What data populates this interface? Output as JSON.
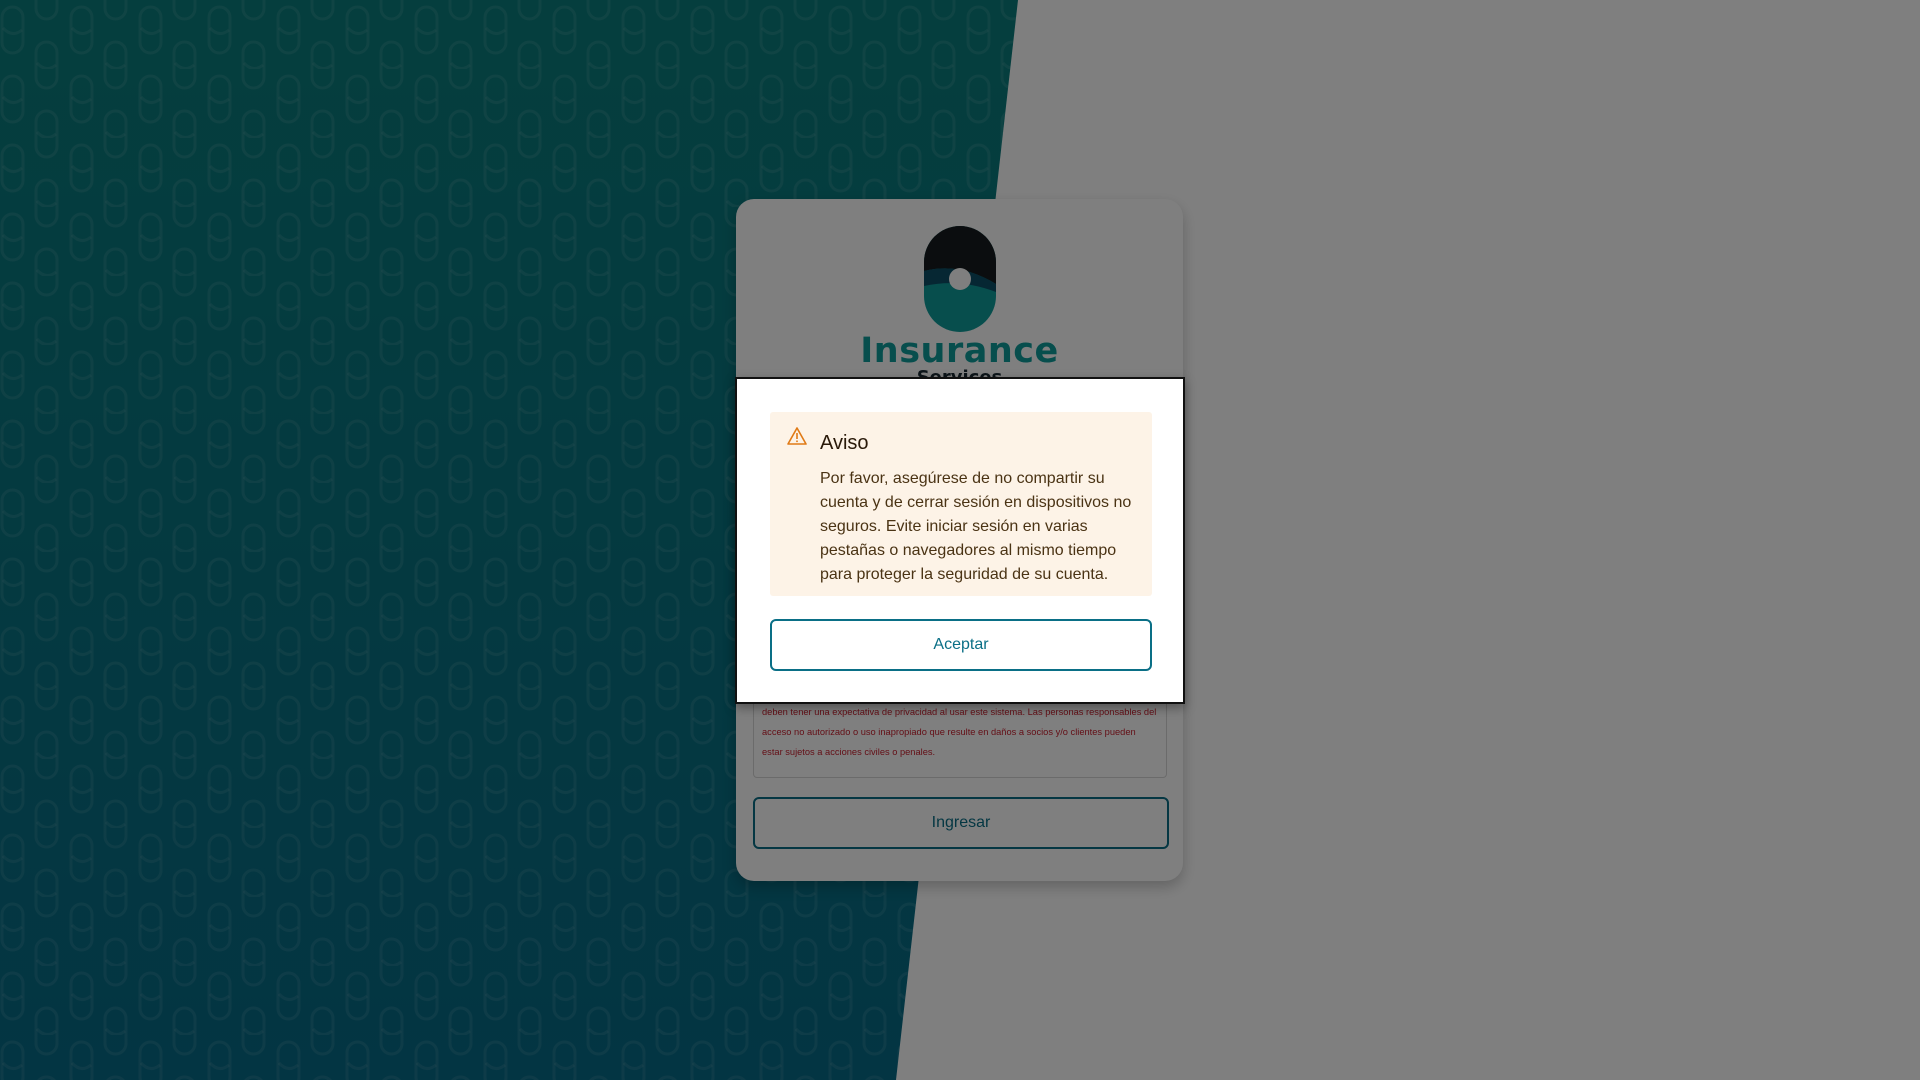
{
  "colors": {
    "teal_top": "#0a7d7c",
    "teal_bottom": "#076a86",
    "brand_teal": "#0f9c9a",
    "button_accent": "#0a6f86",
    "legal_red": "#c8202f",
    "alert_bg": "#fdf3e7",
    "warning_orange": "#e07a16"
  },
  "login": {
    "brand_name": "Insurance",
    "brand_subtitle": "Services",
    "legal_notice": "Este sistema está restringido a personal autorizado para fines comerciales. Las personas no deben tener una expectativa de privacidad al usar este sistema. Las personas responsables del acceso no autorizado o uso inapropiado que resulte en daños a socios y/o clientes pueden estar sujetos a acciones civiles o penales.",
    "submit_label": "Ingresar"
  },
  "modal": {
    "icon": "warning-triangle-icon",
    "title": "Aviso",
    "message": "Por favor, asegúrese de no compartir su cuenta y de cerrar sesión en dispositivos no seguros. Evite iniciar sesión en varias pestañas o navegadores al mismo tiempo para proteger la seguridad de su cuenta.",
    "accept_label": "Aceptar"
  }
}
